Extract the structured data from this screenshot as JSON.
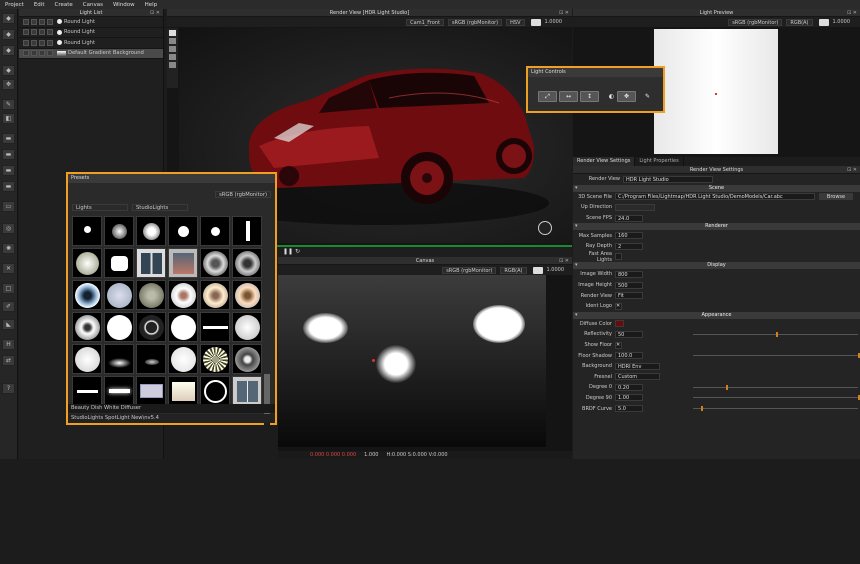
{
  "menu": [
    "Project",
    "Edit",
    "Create",
    "Canvas",
    "Window",
    "Help"
  ],
  "light_list": {
    "title": "Light List",
    "items": [
      "Round Light",
      "Round Light",
      "Round Light",
      "Default Gradient Background"
    ]
  },
  "render_view": {
    "title": "Render View [HDR Light Studio]",
    "camera": "Cam1_Front",
    "color_space": "sRGB (rgbMonitor)",
    "channel": "HSV",
    "exposure": "1.0000"
  },
  "canvas": {
    "title": "Canvas",
    "color_space": "sRGB (rgbMonitor)",
    "channel": "RGB(A)",
    "exposure": "1.0000",
    "status_values": "0.000 0.000 0.000",
    "status_exposure": "1.000",
    "status_coords": "H:0.000 S:0.000 V:0.000"
  },
  "light_preview": {
    "title": "Light Preview",
    "color_space": "sRGB (rgbMonitor)",
    "channel": "RGB(A)",
    "exposure": "1.0000"
  },
  "light_controls": {
    "title": "Light Controls"
  },
  "presets": {
    "title": "Presets",
    "color_space": "sRGB (rgbMonitor)",
    "category": "Lights",
    "library": "StudioLights",
    "selected_name": "Beauty Dish White Diffuser",
    "path": "StudioLights SpotLight New\\nv5.4"
  },
  "settings": {
    "tabs": [
      "Render View Settings",
      "Light Properties"
    ],
    "panel_title": "Render View Settings",
    "render_view_label": "Render View",
    "render_view_value": "HDR Light Studio",
    "sections": {
      "scene": "Scene",
      "renderer": "Renderer",
      "display": "Display",
      "appearance": "Appearance"
    },
    "scene_file_label": "3D Scene File",
    "scene_file": "C:/Program Files/Lightmap/HDR Light Studio/DemoModels/Car.abc",
    "browse": "Browse",
    "up_direction_label": "Up Direction",
    "scene_fps_label": "Scene FPS",
    "scene_fps": "24.0",
    "max_samples_label": "Max Samples",
    "max_samples": "160",
    "ray_depth_label": "Ray Depth",
    "ray_depth": "2",
    "fast_area_label": "Fast Area Lights",
    "image_width_label": "Image Width",
    "image_width": "800",
    "image_height_label": "Image Height",
    "image_height": "500",
    "render_view2_label": "Render View",
    "render_view2": "Fit",
    "ident_logo_label": "Ident Logo",
    "diffuse_color_label": "Diffuse Color",
    "reflectivity_label": "Reflectivity",
    "reflectivity": "50",
    "show_floor_label": "Show Floor",
    "floor_shadow_label": "Floor Shadow",
    "floor_shadow": "100.0",
    "background_label": "Background",
    "background": "HDRI Env",
    "fresnel_label": "Fresnel",
    "fresnel": "Custom",
    "degree0_label": "Degree 0",
    "degree0": "0.20",
    "degree90_label": "Degree 90",
    "degree90": "1.00",
    "brdf_label": "BRDF Curve",
    "brdf": "5.0",
    "reflectivity_level": 0.5,
    "floor_shadow_level": 1.0,
    "degree0_level": 0.2,
    "degree90_level": 1.0,
    "brdf_level": 0.05
  },
  "colors": {
    "accent": "#f0a020",
    "car": "#8a0f12",
    "diffuse": "#6a0a0a"
  }
}
